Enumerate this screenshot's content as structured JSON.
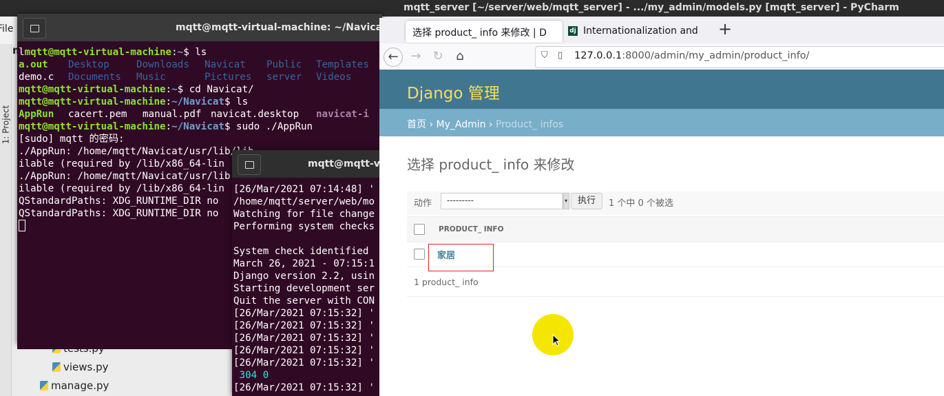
{
  "pycharm": {
    "title": "mqtt_server [~/server/web/mqtt_server] - .../my_admin/models.py [mqtt_server] - PyCharm",
    "menu_file": "File",
    "side_tab": "1: Project",
    "tree_cut_label": "m",
    "tree": [
      "tests.py",
      "views.py",
      "manage.py"
    ]
  },
  "terminal1": {
    "title": "mqtt@mqtt-virtual-machine: ~/Navicat",
    "user_host": "mqtt@mqtt-virtual-machine",
    "prompt_home": "~",
    "prompt_nav": "~/Navicat",
    "cmd_ls": "$ ls",
    "ls_row1": [
      "a.out",
      "Desktop",
      "Downloads",
      "Navicat",
      "Public",
      "Templates"
    ],
    "ls_row2": [
      "demo.c",
      "Documents",
      "Music",
      "Pictures",
      "server",
      "Videos"
    ],
    "cmd_cd": "$ cd Navicat/",
    "navicat_files": [
      "AppRun",
      "cacert.pem",
      "manual.pdf",
      "navicat.desktop"
    ],
    "navicat_dir": "navicat-i",
    "cmd_sudo": "$ sudo ./AppRun",
    "out": [
      "[sudo] mqtt 的密码:",
      "./AppRun: /home/mqtt/Navicat/usr/lib/lib...",
      "ilable (required by /lib/x86_64-lin",
      "./AppRun: /home/mqtt/Navicat/usr/lib",
      "ilable (required by /lib/x86_64-lin",
      "QStandardPaths: XDG_RUNTIME_DIR no",
      "QStandardPaths: XDG_RUNTIME_DIR no"
    ]
  },
  "terminal2": {
    "title": "mqtt@mqtt-vi",
    "lines": [
      "[26/Mar/2021 07:14:48] '",
      "/home/mqtt/server/web/mo",
      "Watching for file change",
      "Performing system checks",
      "",
      "System check identified",
      "March 26, 2021 - 07:15:1",
      "Django version 2.2, usin",
      "Starting development ser",
      "Quit the server with CON",
      "[26/Mar/2021 07:15:32] '",
      "[26/Mar/2021 07:15:32] '",
      "[26/Mar/2021 07:15:32] '",
      "[26/Mar/2021 07:15:32] '",
      "[26/Mar/2021 07:15:32] '"
    ],
    "status_line": " 304 0",
    "last_line": "[26/Mar/2021 07:15:32] '"
  },
  "browser": {
    "tab1": "选择 product_ info 来修改 | D",
    "tab2": "Internationalization and",
    "tab2_favicon": "dj",
    "new_tab": "+",
    "url_host": "127.0.0.1",
    "url_rest": ":8000/admin/my_admin/product_info/"
  },
  "django": {
    "brand": "Django 管理",
    "crumb_home": "首页",
    "crumb_app": "My_Admin",
    "crumb_model": "Product_ infos",
    "crumb_sep": "›",
    "page_title": "选择 product_ info 来修改",
    "action_label": "动作",
    "action_select": "---------",
    "go_button": "执行",
    "selection_count": "1 个中 0 个被选",
    "column_header": "PRODUCT_ INFO",
    "row_link": "家居",
    "footer_count": "1 product_ info"
  },
  "colors": {
    "django_header": "#417690",
    "django_breadcrumbs": "#79aec8",
    "django_brand": "#f5dd5d",
    "terminal_bg": "#300a24",
    "highlight_box": "#e02020",
    "cursor_highlight": "#f5e600"
  }
}
